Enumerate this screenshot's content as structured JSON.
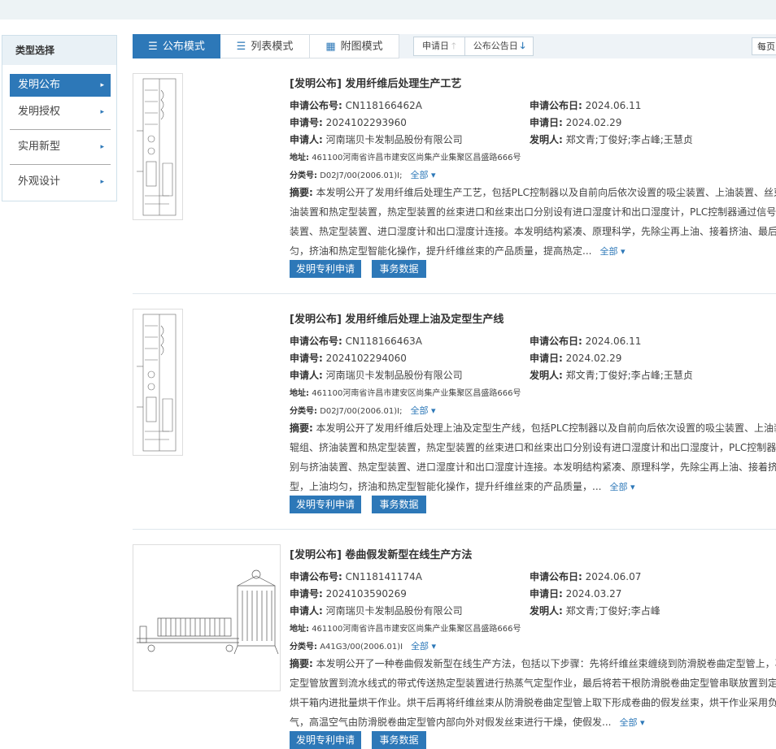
{
  "sidebar": {
    "title": "类型选择",
    "items": [
      {
        "label": "发明公布",
        "active": true
      },
      {
        "label": "发明授权",
        "active": false
      },
      {
        "label": "实用新型",
        "active": false
      },
      {
        "label": "外观设计",
        "active": false
      }
    ]
  },
  "toolbar": {
    "modes": [
      "公布模式",
      "列表模式",
      "附图模式"
    ],
    "active_mode": "公布模式",
    "sort": [
      "申请日",
      "公布公告日"
    ],
    "per_page": "每页"
  },
  "labels": {
    "pub_no": "申请公布号:",
    "pub_date": "申请公布日:",
    "app_no": "申请号:",
    "app_date": "申请日:",
    "applicant": "申请人:",
    "inventor": "发明人:",
    "address": "地址:",
    "class": "分类号:",
    "abstract": "摘要:",
    "all": "全部 ▾",
    "btn_apply": "发明专利申请",
    "btn_affairs": "事务数据"
  },
  "records": [
    {
      "tag": "[发明公布]",
      "title": "发用纤维后处理生产工艺",
      "pub_no": "CN118166462A",
      "pub_date": "2024.06.11",
      "app_no": "2024102293960",
      "app_date": "2024.02.29",
      "applicant": "河南瑞贝卡发制品股份有限公司",
      "inventor": "郑文青;丁俊好;李占峰;王慧贞",
      "address": "461100河南省许昌市建安区尚集产业集聚区昌盛路666号",
      "class": "D02J7/00(2006.01)I;",
      "abstract_lines": [
        "本发明公开了发用纤维后处理生产工艺，包括PLC控制器以及自前向后依次设置的吸尘装置、上油装置、丝束分",
        "油装置和热定型装置，热定型装置的丝束进口和丝束出口分别设有进口湿度计和出口湿度计，PLC控制器通过信号电线",
        "装置、热定型装置、进口湿度计和出口湿度计连接。本发明结构紧凑、原理科学，先除尘再上油、接着挤油、最后热定",
        "匀，挤油和热定型智能化操作，提升纤维丝束的产品质量，提高热定..."
      ]
    },
    {
      "tag": "[发明公布]",
      "title": "发用纤维后处理上油及定型生产线",
      "pub_no": "CN118166463A",
      "pub_date": "2024.06.11",
      "app_no": "2024102294060",
      "app_date": "2024.02.29",
      "applicant": "河南瑞贝卡发制品股份有限公司",
      "inventor": "郑文青;丁俊好;李占峰;王慧贞",
      "address": "461100河南省许昌市建安区尚集产业集聚区昌盛路666号",
      "class": "D02J7/00(2006.01)I;",
      "abstract_lines": [
        "本发明公开了发用纤维后处理上油及定型生产线，包括PLC控制器以及自前向后依次设置的吸尘装置、上油装置",
        "辊组、挤油装置和热定型装置，热定型装置的丝束进口和丝束出口分别设有进口湿度计和出口湿度计，PLC控制器通过",
        "别与挤油装置、热定型装置、进口湿度计和出口湿度计连接。本发明结构紧凑、原理科学，先除尘再上油、接着挤油、",
        "型，上油均匀，挤油和热定型智能化操作，提升纤维丝束的产品质量，..."
      ]
    },
    {
      "tag": "[发明公布]",
      "title": "卷曲假发新型在线生产方法",
      "pub_no": "CN118141174A",
      "pub_date": "2024.06.07",
      "app_no": "2024103590269",
      "app_date": "2024.03.27",
      "applicant": "河南瑞贝卡发制品股份有限公司",
      "inventor": "郑文青;丁俊好;李占峰",
      "address": "461100河南省许昌市建安区尚集产业集聚区昌盛路666号",
      "class": "A41G3/00(2006.01)I",
      "abstract_lines": [
        "本发明公开了一种卷曲假发新型在线生产方法，包括以下步骤：先将纤维丝束缠绕到防滑脱卷曲定型管上，再将",
        "定型管放置到流水线式的带式传送热定型装置进行热蒸气定型作业，最后将若干根防滑脱卷曲定型管串联放置到定型",
        "烘干箱内进批量烘干作业。烘干后再将纤维丝束从防滑脱卷曲定型管上取下形成卷曲的假发丝束，烘干作业采用负压",
        "气，高温空气由防滑脱卷曲定型管内部向外对假发丝束进行干燥，使假发..."
      ]
    }
  ]
}
